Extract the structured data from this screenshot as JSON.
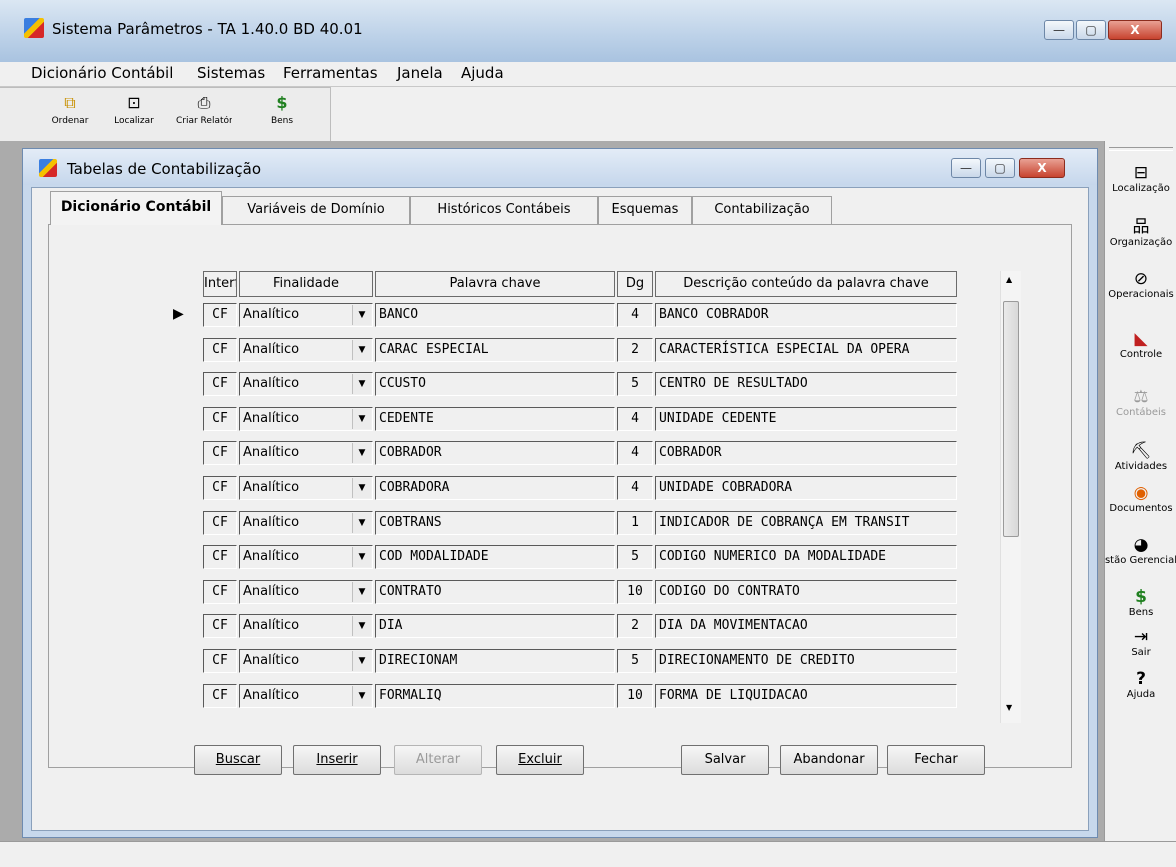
{
  "window": {
    "title": "Sistema Parâmetros -  TA 1.40.0 BD 40.01",
    "btn_min": "—",
    "btn_max": "▢",
    "btn_close": "X"
  },
  "menu": [
    "Dicionário Contábil",
    "Sistemas",
    "Ferramentas",
    "Janela",
    "Ajuda"
  ],
  "toolbar": [
    {
      "label": "Ordenar",
      "icon": "sort-icon",
      "glyph": "⧉"
    },
    {
      "label": "Localizar",
      "icon": "binoculars-icon",
      "glyph": "⊡"
    },
    {
      "label": "Criar Relatório",
      "icon": "printer-icon",
      "glyph": "⎙"
    },
    {
      "label": "Bens",
      "icon": "money-bag-icon",
      "glyph": "$"
    }
  ],
  "child": {
    "title": "Tabelas de Contabilização",
    "btn_min": "—",
    "btn_max": "▢",
    "btn_close": "X"
  },
  "tabs": [
    "Dicionário Contábil",
    "Variáveis de Domínio",
    "Históricos Contábeis",
    "Esquemas",
    "Contabilização"
  ],
  "grid": {
    "headers": {
      "interf": "Interf",
      "finalidade": "Finalidade",
      "palavra": "Palavra chave",
      "dg": "Dg",
      "descricao": "Descrição conteúdo da palavra chave"
    },
    "rows": [
      {
        "interf": "CF",
        "finalidade": "Analítico",
        "palavra": "BANCO",
        "dg": "4",
        "descricao": "BANCO COBRADOR"
      },
      {
        "interf": "CF",
        "finalidade": "Analítico",
        "palavra": "CARAC ESPECIAL",
        "dg": "2",
        "descricao": "CARACTERÍSTICA ESPECIAL DA OPERA"
      },
      {
        "interf": "CF",
        "finalidade": "Analítico",
        "palavra": "CCUSTO",
        "dg": "5",
        "descricao": "CENTRO DE RESULTADO"
      },
      {
        "interf": "CF",
        "finalidade": "Analítico",
        "palavra": "CEDENTE",
        "dg": "4",
        "descricao": "UNIDADE CEDENTE"
      },
      {
        "interf": "CF",
        "finalidade": "Analítico",
        "palavra": "COBRADOR",
        "dg": "4",
        "descricao": "COBRADOR"
      },
      {
        "interf": "CF",
        "finalidade": "Analítico",
        "palavra": "COBRADORA",
        "dg": "4",
        "descricao": "UNIDADE COBRADORA"
      },
      {
        "interf": "CF",
        "finalidade": "Analítico",
        "palavra": "COBTRANS",
        "dg": "1",
        "descricao": "INDICADOR DE COBRANÇA EM TRANSIT"
      },
      {
        "interf": "CF",
        "finalidade": "Analítico",
        "palavra": "COD MODALIDADE",
        "dg": "5",
        "descricao": "CODIGO NUMERICO DA MODALIDADE"
      },
      {
        "interf": "CF",
        "finalidade": "Analítico",
        "palavra": "CONTRATO",
        "dg": "10",
        "descricao": "CODIGO DO CONTRATO"
      },
      {
        "interf": "CF",
        "finalidade": "Analítico",
        "palavra": "DIA",
        "dg": "2",
        "descricao": "DIA DA MOVIMENTACAO"
      },
      {
        "interf": "CF",
        "finalidade": "Analítico",
        "palavra": "DIRECIONAM",
        "dg": "5",
        "descricao": "DIRECIONAMENTO DE CREDITO"
      },
      {
        "interf": "CF",
        "finalidade": "Analítico",
        "palavra": "FORMALIQ",
        "dg": "10",
        "descricao": "FORMA DE LIQUIDACAO"
      }
    ]
  },
  "buttons": {
    "buscar": "Buscar",
    "inserir": "Inserir",
    "alterar": "Alterar",
    "excluir": "Excluir",
    "salvar": "Salvar",
    "abandonar": "Abandonar",
    "fechar": "Fechar"
  },
  "sidebar": [
    {
      "label": "Localização",
      "icon": "location-icon",
      "glyph": "⊟",
      "color": "#000000"
    },
    {
      "label": "Organização",
      "icon": "organization-icon",
      "glyph": "品",
      "color": "#000000"
    },
    {
      "label": "Operacionais",
      "icon": "operations-icon",
      "glyph": "⊘",
      "color": "#000000"
    },
    {
      "label": "Controle",
      "icon": "control-icon",
      "glyph": "◣",
      "color": "#c02020"
    },
    {
      "label": "Contábeis",
      "icon": "scales-icon",
      "glyph": "⚖",
      "color": "#9a9a9a"
    },
    {
      "label": "Atividades",
      "icon": "activities-icon",
      "glyph": "⛏",
      "color": "#000000"
    },
    {
      "label": "Documentos",
      "icon": "documents-icon",
      "glyph": "◉",
      "color": "#e06000"
    },
    {
      "label": "Gestão Gerencial",
      "icon": "eye-icon",
      "glyph": "◕",
      "color": "#000000"
    },
    {
      "label": "Bens",
      "icon": "money-bag-icon",
      "glyph": "$",
      "color": "#208020"
    },
    {
      "label": "Sair",
      "icon": "exit-door-icon",
      "glyph": "⇥",
      "color": "#000000"
    },
    {
      "label": "Ajuda",
      "icon": "help-icon",
      "glyph": "?",
      "color": "#000000"
    }
  ]
}
